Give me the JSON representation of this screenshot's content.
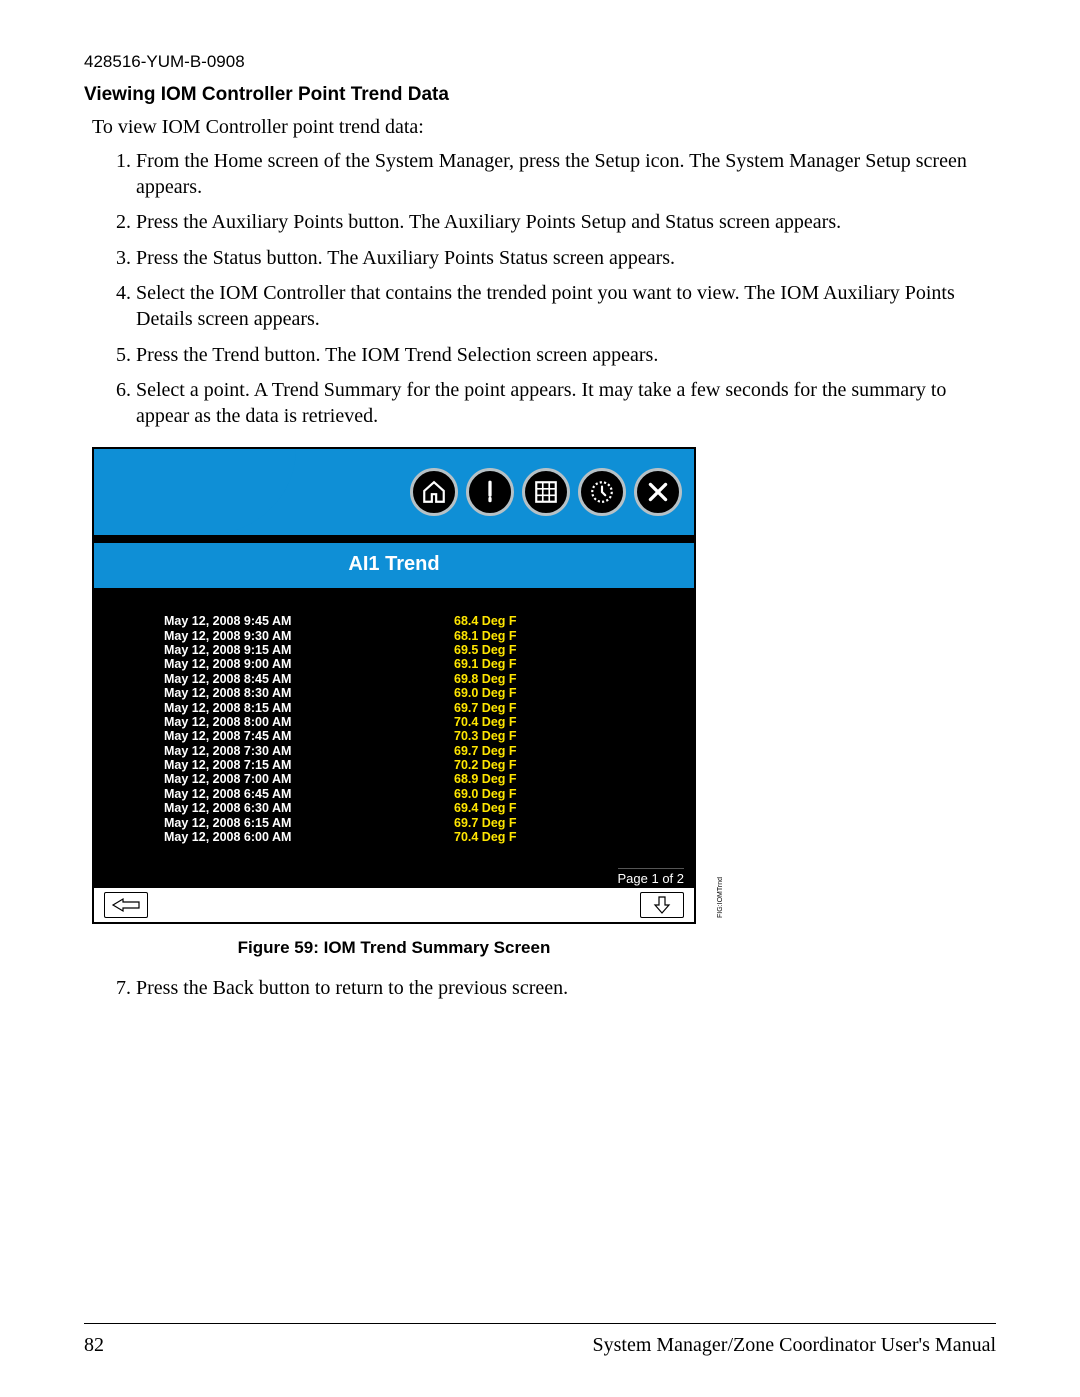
{
  "doc_id": "428516-YUM-B-0908",
  "section_title": "Viewing IOM Controller Point Trend Data",
  "intro": "To view IOM Controller point trend data:",
  "steps": [
    "From the Home screen of the System Manager, press the Setup icon. The System Manager Setup screen appears.",
    "Press the Auxiliary Points button. The Auxiliary Points Setup and Status screen appears.",
    "Press the Status button. The Auxiliary Points Status screen appears.",
    "Select the IOM Controller that contains the trended point you want to view. The IOM Auxiliary Points Details screen appears.",
    "Press the Trend button. The IOM Trend Selection screen appears.",
    "Select a point. A Trend Summary for the point appears. It may take a few seconds for the summary to appear as the data is retrieved."
  ],
  "device": {
    "title": "AI1 Trend",
    "rows": [
      {
        "ts": "May 12, 2008 9:45 AM",
        "val": "68.4 Deg F"
      },
      {
        "ts": "May 12, 2008 9:30 AM",
        "val": "68.1 Deg F"
      },
      {
        "ts": "May 12, 2008 9:15 AM",
        "val": "69.5 Deg F"
      },
      {
        "ts": "May 12, 2008 9:00 AM",
        "val": "69.1 Deg F"
      },
      {
        "ts": "May 12, 2008 8:45 AM",
        "val": "69.8 Deg F"
      },
      {
        "ts": "May 12, 2008 8:30 AM",
        "val": "69.0 Deg F"
      },
      {
        "ts": "May 12, 2008 8:15 AM",
        "val": "69.7 Deg F"
      },
      {
        "ts": "May 12, 2008 8:00 AM",
        "val": "70.4 Deg F"
      },
      {
        "ts": "May 12, 2008 7:45 AM",
        "val": "70.3 Deg F"
      },
      {
        "ts": "May 12, 2008 7:30 AM",
        "val": "69.7 Deg F"
      },
      {
        "ts": "May 12, 2008 7:15 AM",
        "val": "70.2 Deg F"
      },
      {
        "ts": "May 12, 2008 7:00 AM",
        "val": "68.9 Deg F"
      },
      {
        "ts": "May 12, 2008 6:45 AM",
        "val": "69.0 Deg F"
      },
      {
        "ts": "May 12, 2008 6:30 AM",
        "val": "69.4 Deg F"
      },
      {
        "ts": "May 12, 2008 6:15 AM",
        "val": "69.7 Deg F"
      },
      {
        "ts": "May 12, 2008 6:00 AM",
        "val": "70.4 Deg F"
      }
    ],
    "pager": "Page 1 of 2",
    "side_label": "FIG:IOMTrnd"
  },
  "figure_caption": "Figure 59: IOM Trend Summary Screen",
  "steps_cont": [
    "Press the Back button to return to the previous screen."
  ],
  "footer": {
    "page_no": "82",
    "manual": "System Manager/Zone Coordinator User's Manual"
  }
}
